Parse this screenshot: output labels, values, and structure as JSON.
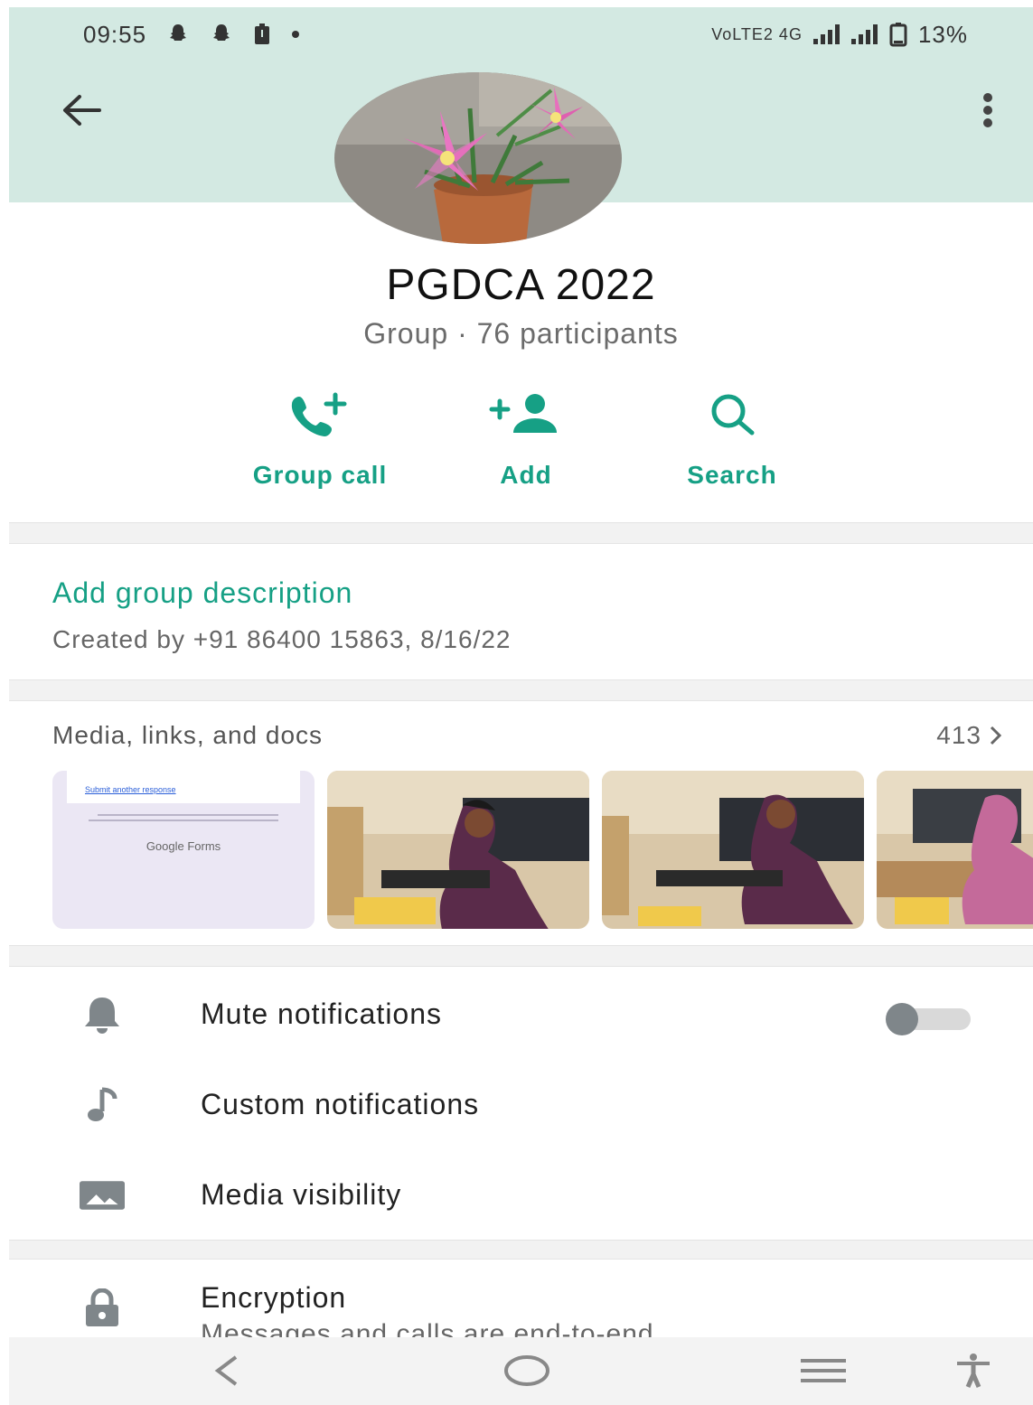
{
  "status_bar": {
    "time": "09:55",
    "network_label": "VoLTE2 4G",
    "battery": "13%",
    "icons": [
      "snapchat-icon",
      "snapchat-icon",
      "battery-saver-icon",
      "dot-icon",
      "signal-icon",
      "signal-icon",
      "battery-icon"
    ]
  },
  "header": {
    "back_icon": "arrow-left-icon",
    "menu_icon": "more-vert-icon"
  },
  "group": {
    "name": "PGDCA 2022",
    "subtitle": "Group · 76 participants"
  },
  "actions": [
    {
      "label": "Group call",
      "icon": "add-call-icon"
    },
    {
      "label": "Add",
      "icon": "add-person-icon"
    },
    {
      "label": "Search",
      "icon": "search-icon"
    }
  ],
  "description": {
    "link": "Add group description",
    "created": "Created by +91 86400 15863, 8/16/22"
  },
  "media": {
    "title": "Media, links, and docs",
    "count": "413",
    "thumb_doc_text": "Google Forms",
    "thumb_doc_link": "Submit another response"
  },
  "settings": [
    {
      "label": "Mute notifications",
      "icon": "bell-icon",
      "toggle": false
    },
    {
      "label": "Custom notifications",
      "icon": "music-note-icon"
    },
    {
      "label": "Media visibility",
      "icon": "image-icon"
    }
  ],
  "encryption": {
    "title": "Encryption",
    "subtitle": "Messages and calls are end-to-end"
  },
  "colors": {
    "accent": "#16a085",
    "header_bg": "#d3e9e2"
  }
}
